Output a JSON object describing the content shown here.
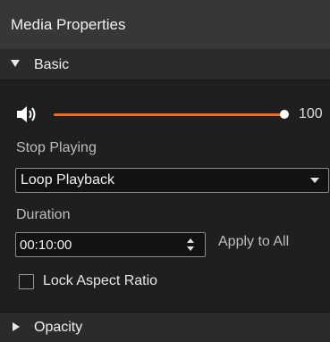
{
  "panel": {
    "title": "Media Properties"
  },
  "basic_section": {
    "label": "Basic",
    "expanded": true
  },
  "volume": {
    "icon": "speaker-volume-icon",
    "value": "100",
    "level_percent": 100,
    "accent_color": "#f26d1d"
  },
  "stop_playing": {
    "label": "Stop Playing",
    "selected": "Loop Playback"
  },
  "duration": {
    "label": "Duration",
    "value": "00:10:00",
    "apply_label": "Apply to All"
  },
  "lock_aspect": {
    "label": "Lock Aspect Ratio",
    "checked": false
  },
  "opacity_section": {
    "label": "Opacity",
    "expanded": false
  }
}
